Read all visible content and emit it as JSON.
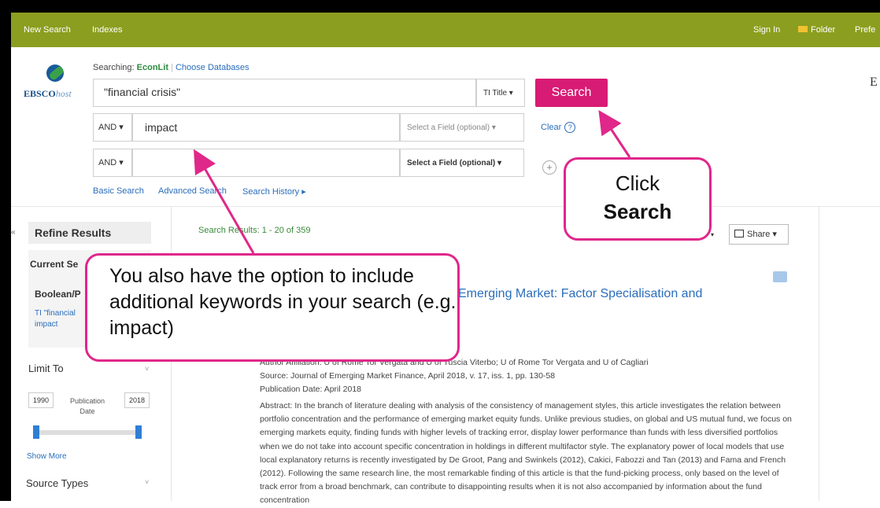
{
  "topnav": {
    "new_search": "New Search",
    "indexes": "Indexes",
    "sign_in": "Sign In",
    "folder": "Folder",
    "preferences": "Prefe"
  },
  "header": {
    "logo_main": "EBSCO",
    "logo_sub": "host",
    "searching_label": "Searching:",
    "database": "EconLit",
    "choose_databases": "Choose Databases",
    "right_edge_text": "E"
  },
  "search": {
    "row1_value": "\"financial crisis\"",
    "row1_field": "TI Title",
    "row2_bool": "AND",
    "row2_value": "impact",
    "row2_field": "Select a Field (optional)",
    "row3_bool": "AND",
    "row3_value": "",
    "row3_field": "Select a Field (optional)",
    "search_button": "Search",
    "clear": "Clear",
    "help": "?",
    "add_row": "+",
    "links": [
      "Basic Search",
      "Advanced Search",
      "Search History ▸"
    ]
  },
  "sidebar": {
    "collapse": "«",
    "refine_results": "Refine Results",
    "current_search": "Current Se",
    "boolean_phrase": "Boolean/P",
    "query_line1": "TI \"financial",
    "query_line2": "impact",
    "limit_to": "Limit To",
    "year_from": "1990",
    "year_to": "2018",
    "publication_date": "Publication Date",
    "slider_from_fraction": 0.0,
    "slider_to_fraction": 1.0,
    "show_more": "Show More",
    "source_types": "Source Types"
  },
  "results": {
    "count_text": "Search Results: 1 - 20 of 359",
    "share": "Share",
    "title_fragment": "Emerging Market: Factor Specialisation and",
    "author_affiliation": "Author Affiliation: U of Rome Tor Vergata and U of Tuscia Viterbo; U of Rome Tor Vergata and U of Cagliari",
    "source": "Source: Journal of Emerging Market Finance, April 2018, v. 17, iss. 1, pp. 130-58",
    "pub_date": "Publication Date: April 2018",
    "abstract": "Abstract: In the branch of literature dealing with analysis of the consistency of management styles, this article investigates the relation between portfolio concentration and the performance of emerging market equity funds. Unlike previous studies, on global and US mutual fund, we focus on emerging markets equity, finding funds with higher levels of tracking error, display lower performance than funds with less diversified portfolios when we do not take into account specific concentration in holdings in different multifactor style. The explanatory power of local models that use local explanatory returns is recently investigated by De Groot, Pang and Swinkels (2012), Cakici, Fabozzi and Tan (2013) and Fama and French (2012). Following the same research line, the most remarkable finding of this article is that the fund-picking process, only based on the level of track error from a broad benchmark, can contribute to disappointing results when it is not also accompanied by information about the fund concentration"
  },
  "callouts": {
    "left": "You also have the option to include additional keywords in your search (e.g. impact)",
    "right_line1": "Click",
    "right_line2": "Search"
  },
  "colors": {
    "nav_bar": "#8c9e1f",
    "search_button": "#d81b74",
    "callout_border": "#e0278a",
    "link": "#2a6ebb"
  },
  "icons": [
    "folder-icon",
    "help-icon",
    "add-row-icon",
    "share-icon",
    "document-icon",
    "collapse-icon",
    "chevron-down-icon"
  ]
}
